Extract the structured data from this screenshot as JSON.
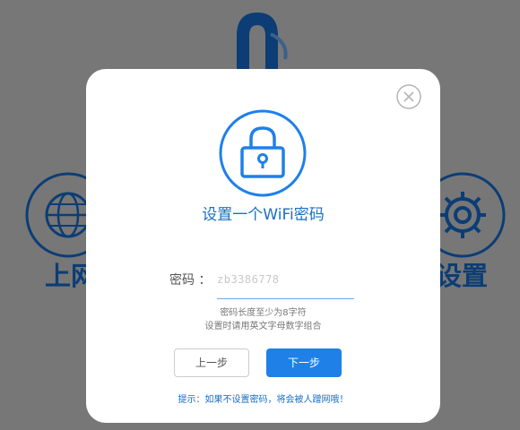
{
  "background": {
    "left_label": "上网",
    "right_label": "设置",
    "logo_icon": "brand-logo-icon",
    "left_icon": "globe-icon",
    "right_icon": "gear-icon"
  },
  "dialog": {
    "close_icon": "close-icon",
    "lock_icon": "lock-icon",
    "title": "设置一个WiFi密码",
    "password_label": "密码 ：",
    "password_value": "zb3386778",
    "hint_line1": "密码长度至少为8字符",
    "hint_line2": "设置时请用英文字母数字组合",
    "prev_label": "上一步",
    "next_label": "下一步",
    "tip": "提示：如果不设置密码，将会被人蹭网哦！"
  },
  "colors": {
    "accent": "#1f80e8",
    "text_blue": "#1a6fc4",
    "overlay": "#777777",
    "background_brand": "#0c3d75"
  }
}
